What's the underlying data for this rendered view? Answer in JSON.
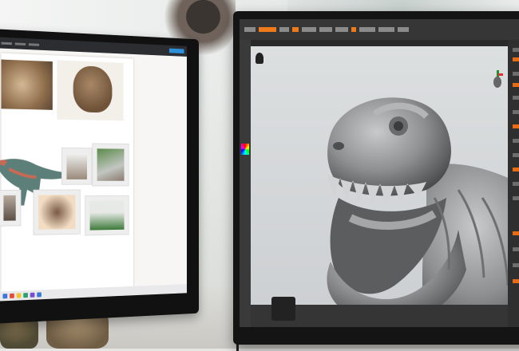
{
  "scene": {
    "description_items": [
      "left-monitor",
      "right-monitor",
      "desk",
      "figurines"
    ]
  },
  "colors": {
    "zbrush_orange": "#f07a1a",
    "sculpt_clay": "#8f9092",
    "viewport_bg": "#d6d9da",
    "bezel": "#141414"
  },
  "icons": {
    "gizmo": "axis-gizmo-icon",
    "figure": "figure-icon"
  }
}
